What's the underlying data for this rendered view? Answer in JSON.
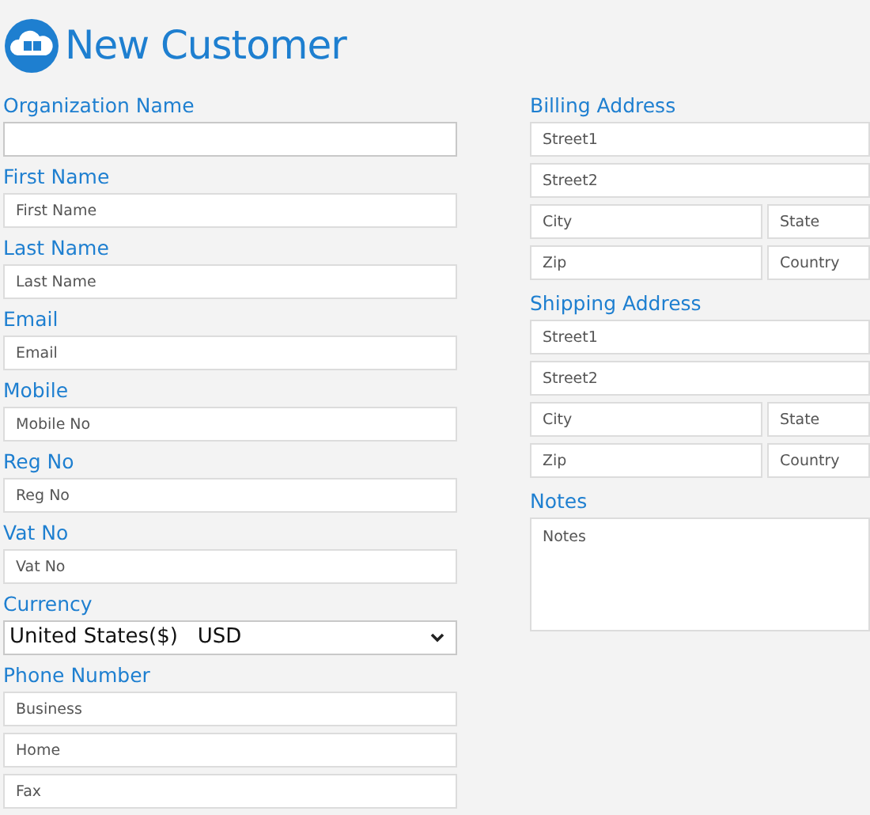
{
  "title": "New Customer",
  "left_fields": [
    {
      "label": "Organization Name",
      "kind": "text"
    },
    {
      "label": "First Name",
      "kind": "text",
      "placeholder": "First Name"
    },
    {
      "label": "Last Name",
      "kind": "text",
      "placeholder": "Last Name"
    },
    {
      "label": "Email",
      "kind": "text",
      "placeholder": "Email"
    },
    {
      "label": "Mobile",
      "kind": "text",
      "placeholder": "Mobile No"
    },
    {
      "label": "Reg No",
      "kind": "text",
      "placeholder": "Reg No"
    },
    {
      "label": "Vat No",
      "kind": "text",
      "placeholder": "Vat No"
    },
    {
      "label": "Currency",
      "kind": "select",
      "value": "United States($)   USD"
    },
    {
      "label": "Phone Number",
      "kind": "multi",
      "placeholders": [
        "Business",
        "Home",
        "Fax"
      ]
    }
  ],
  "right_sections": [
    {
      "label": "Billing Address",
      "kind": "address",
      "rows": [
        [
          {
            "placeholder": "Street1"
          }
        ],
        [
          {
            "placeholder": "Street2"
          }
        ],
        [
          {
            "placeholder": "City"
          },
          {
            "placeholder": "State"
          }
        ],
        [
          {
            "placeholder": "Zip"
          },
          {
            "placeholder": "Country"
          }
        ]
      ]
    },
    {
      "label": "Shipping Address",
      "kind": "address",
      "rows": [
        [
          {
            "placeholder": "Street1"
          }
        ],
        [
          {
            "placeholder": "Street2"
          }
        ],
        [
          {
            "placeholder": "City"
          },
          {
            "placeholder": "State"
          }
        ],
        [
          {
            "placeholder": "Zip"
          },
          {
            "placeholder": "Country"
          }
        ]
      ]
    },
    {
      "label": "Notes",
      "kind": "notes",
      "placeholder": "Notes"
    }
  ]
}
